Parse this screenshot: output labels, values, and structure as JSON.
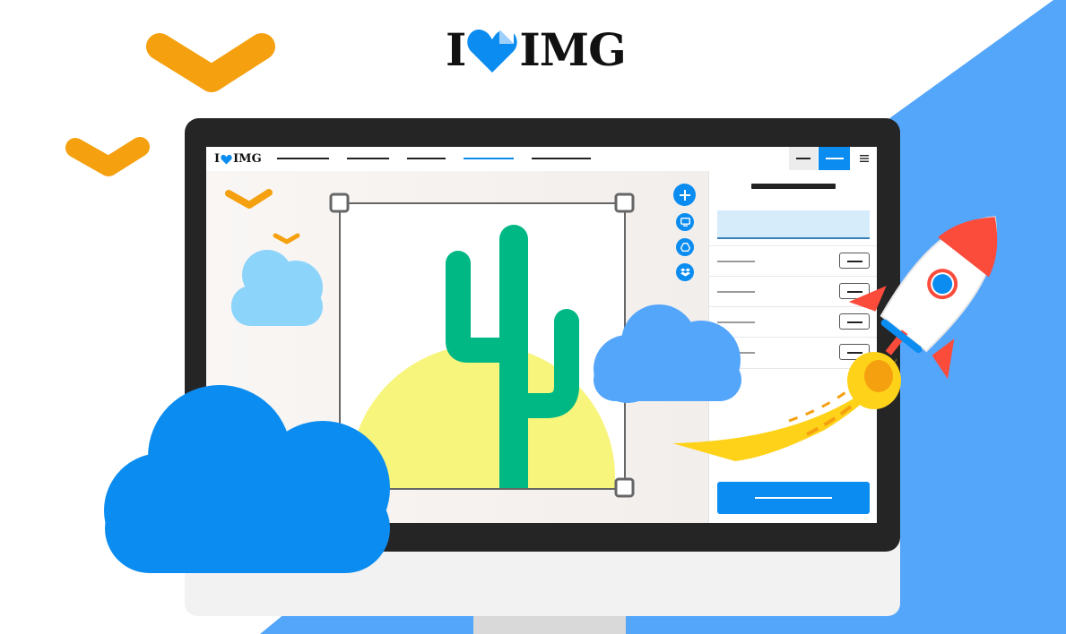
{
  "brand": {
    "text_left": "I",
    "text_right": "IMG"
  },
  "app": {
    "logo_left": "I",
    "logo_right": "IMG",
    "nav_items": [
      "",
      "",
      "",
      "",
      ""
    ],
    "active_nav_index": 3,
    "toolbar": {
      "zoom_out_icon": "minus-icon",
      "zoom_in_icon": "minus-icon",
      "menu_icon": "hamburger-icon"
    },
    "upload_sources": [
      {
        "icon": "plus-icon"
      },
      {
        "icon": "monitor-icon"
      },
      {
        "icon": "google-drive-icon"
      },
      {
        "icon": "dropbox-icon"
      }
    ],
    "sidebar": {
      "title": "",
      "input_value": "",
      "rows": [
        {
          "label": "",
          "value": ""
        },
        {
          "label": "",
          "value": ""
        },
        {
          "label": "",
          "value": ""
        },
        {
          "label": "",
          "value": ""
        }
      ],
      "process_button_label": ""
    }
  },
  "colors": {
    "accent_blue": "#0a8cf0",
    "background_blue": "#54a6fb",
    "bird_orange": "#f5a00f",
    "cactus_green": "#00b884",
    "sun_yellow": "#f7f57c",
    "rocket_red": "#fb4b3b",
    "monitor_dark": "#252525"
  }
}
